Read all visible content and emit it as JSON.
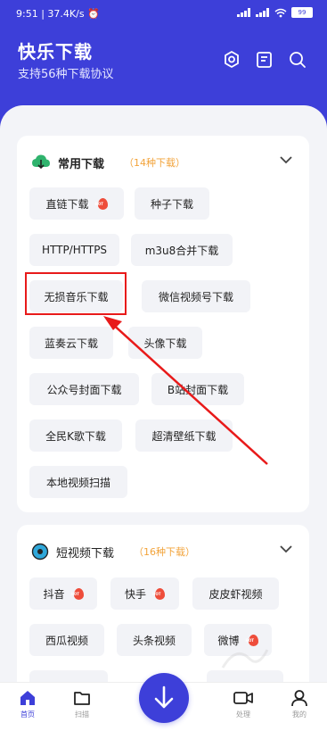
{
  "status_bar": {
    "time": "9:51",
    "speed": "37.4K/s",
    "battery": "99"
  },
  "header": {
    "title": "快乐下载",
    "subtitle": "支持56种下载协议",
    "icons": [
      "settings-icon",
      "notes-icon",
      "search-icon"
    ]
  },
  "common_section": {
    "title": "常用下载",
    "count": "（14种下载）",
    "items": [
      {
        "label": "直链下载",
        "hot": true
      },
      {
        "label": "种子下载",
        "hot": false
      },
      {
        "label": "HTTP/HTTPS",
        "hot": false
      },
      {
        "label": "m3u8合并下载",
        "hot": false
      },
      {
        "label": "无损音乐下载",
        "hot": false
      },
      {
        "label": "微信视频号下载",
        "hot": false
      },
      {
        "label": "蓝奏云下载",
        "hot": false
      },
      {
        "label": "头像下载",
        "hot": false
      },
      {
        "label": "公众号封面下载",
        "hot": false
      },
      {
        "label": "B站封面下载",
        "hot": false
      },
      {
        "label": "全民K歌下载",
        "hot": false
      },
      {
        "label": "超清壁纸下载",
        "hot": false
      },
      {
        "label": "本地视频扫描",
        "hot": false
      }
    ]
  },
  "short_video_section": {
    "title": "短视频下载",
    "count": "（16种下载）",
    "items": [
      {
        "label": "抖音",
        "hot": true
      },
      {
        "label": "快手",
        "hot": true
      },
      {
        "label": "皮皮虾视频",
        "hot": false
      },
      {
        "label": "西瓜视频",
        "hot": false
      },
      {
        "label": "头条视频",
        "hot": false
      },
      {
        "label": "微博",
        "hot": true
      }
    ]
  },
  "tabbar": {
    "home": "首页",
    "scan": "扫描",
    "process": "处理",
    "mine": "我的"
  },
  "colors": {
    "primary": "#3d3fd9",
    "accent_orange": "#f2a33a",
    "hot_red": "#ee4d3b",
    "annotation_red": "#e81a1a"
  }
}
